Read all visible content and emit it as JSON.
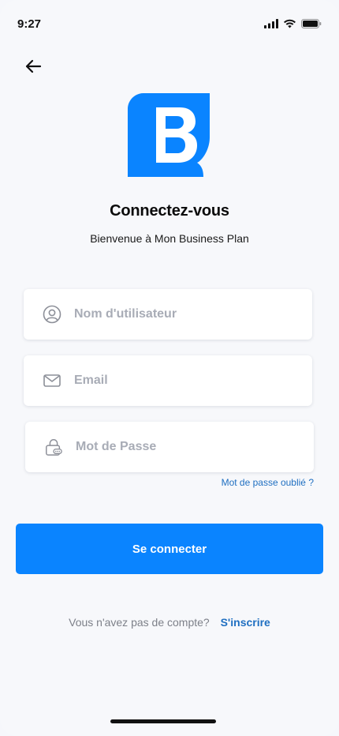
{
  "status_bar": {
    "time": "9:27"
  },
  "header": {
    "back_icon": "arrow-left-icon",
    "title": "Connectez-vous",
    "subtitle": "Bienvenue à Mon Business Plan"
  },
  "form": {
    "username": {
      "placeholder": "Nom d'utilisateur",
      "value": "",
      "icon": "user-circle-icon"
    },
    "email": {
      "placeholder": "Email",
      "value": "",
      "icon": "envelope-icon"
    },
    "password": {
      "placeholder": "Mot de Passe",
      "value": "",
      "icon": "lock-icon"
    },
    "forgot_label": "Mot de passe oublié ?",
    "submit_label": "Se connecter"
  },
  "footer": {
    "prompt": "Vous n'avez pas de compte?",
    "signup_label": "S'inscrire"
  },
  "colors": {
    "primary": "#0a84ff",
    "link": "#1f6fc1",
    "background": "#f7f8fb"
  }
}
